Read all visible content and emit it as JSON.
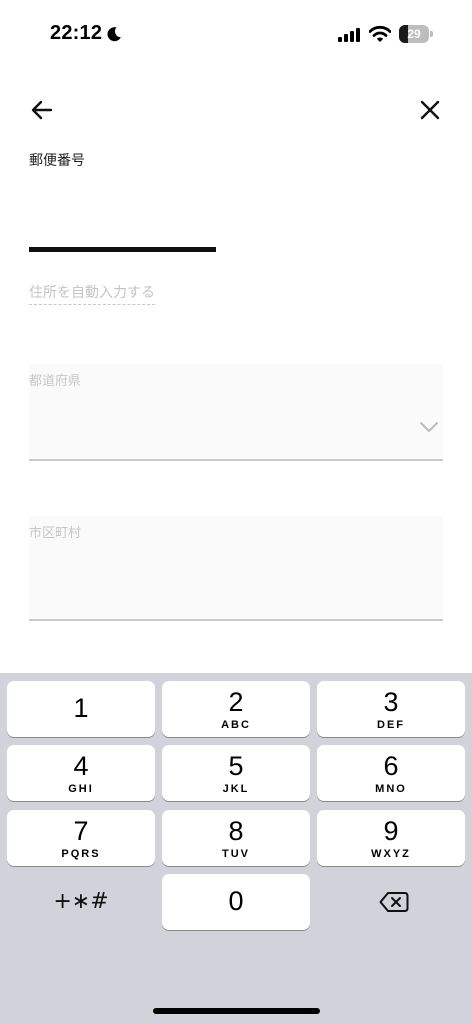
{
  "status_bar": {
    "time": "22:12",
    "battery_percent": "29",
    "battery_level": 0.29,
    "icons": [
      "moon-icon",
      "signal-icon",
      "wifi-icon",
      "battery-icon"
    ]
  },
  "nav": {
    "back_icon": "arrow-left-icon",
    "close_icon": "close-icon"
  },
  "form": {
    "postal_code_label": "郵便番号",
    "postal_code_value": "",
    "autofill_link": "住所を自動入力する",
    "prefecture_label": "都道府県",
    "prefecture_value": "",
    "city_label": "市区町村",
    "city_value": ""
  },
  "keyboard": {
    "keys": [
      {
        "num": "1",
        "letters": ""
      },
      {
        "num": "2",
        "letters": "ABC"
      },
      {
        "num": "3",
        "letters": "DEF"
      },
      {
        "num": "4",
        "letters": "GHI"
      },
      {
        "num": "5",
        "letters": "JKL"
      },
      {
        "num": "6",
        "letters": "MNO"
      },
      {
        "num": "7",
        "letters": "PQRS"
      },
      {
        "num": "8",
        "letters": "TUV"
      },
      {
        "num": "9",
        "letters": "WXYZ"
      },
      {
        "num": "0",
        "letters": ""
      }
    ],
    "symbols_label": "+∗#",
    "delete_icon": "backspace-icon"
  },
  "colors": {
    "keyboard_bg": "#d2d3da",
    "placeholder_text": "#c7c7c7",
    "input_underline": "#111111"
  }
}
